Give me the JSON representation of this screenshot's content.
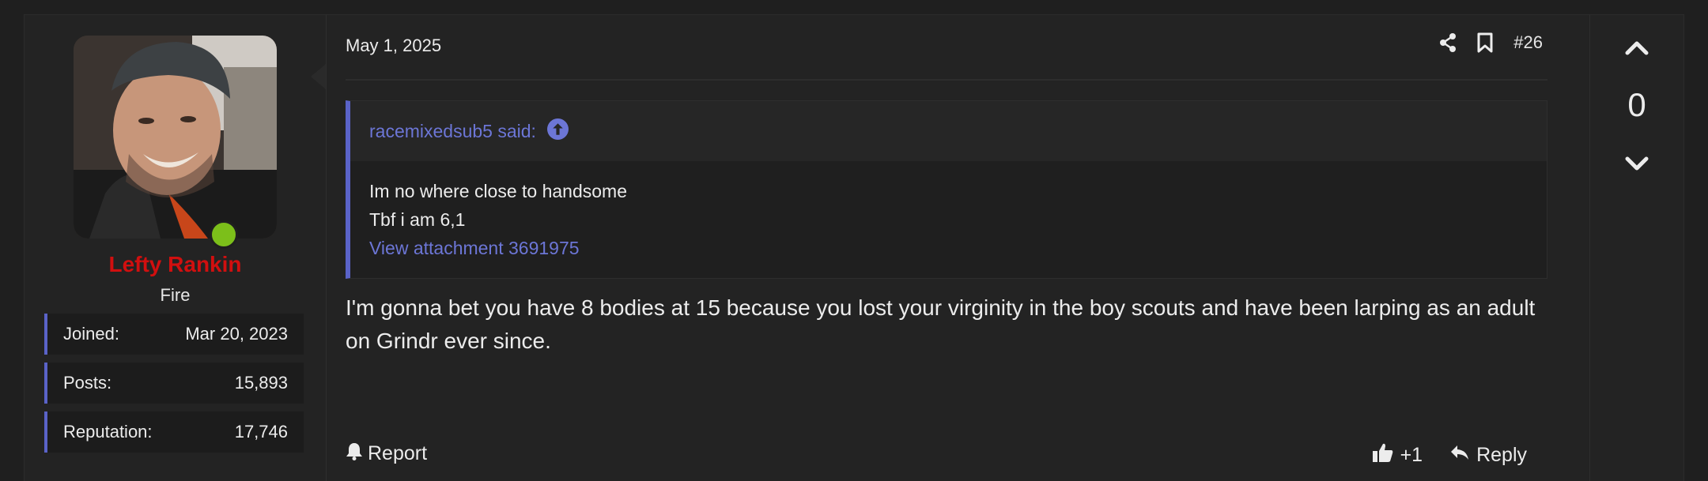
{
  "post": {
    "date": "May 1, 2025",
    "number": "#26",
    "message": "I'm gonna bet you have 8 bodies at 15 because you lost your virginity in the boy scouts and have been larping as an adult on Grindr ever since."
  },
  "user": {
    "name": "Lefty Rankin",
    "title": "Fire",
    "stats": [
      {
        "label": "Joined:",
        "value": "Mar 20, 2023"
      },
      {
        "label": "Posts:",
        "value": "15,893"
      },
      {
        "label": "Reputation:",
        "value": "17,746"
      }
    ],
    "online_color": "#7cbf1a",
    "name_color": "#d10f0f"
  },
  "quote": {
    "author": "racemixedsub5 said:",
    "lines": [
      "Im no where close to handsome",
      "Tbf i am 6,1"
    ],
    "attachment": "View attachment 3691975"
  },
  "footer": {
    "report": "Report",
    "like": "+1",
    "reply": "Reply"
  },
  "vote": {
    "count": "0"
  },
  "accent": "#5a63c8",
  "link_color": "#6c76d6"
}
